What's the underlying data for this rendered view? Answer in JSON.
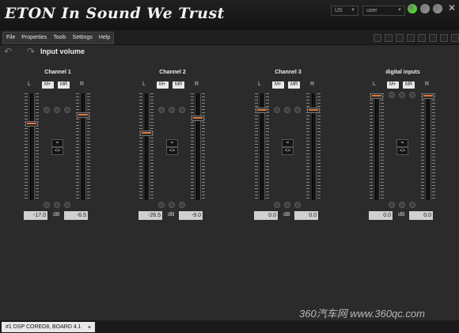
{
  "header": {
    "logo_text": "ETON In Sound We Trust",
    "language": "US",
    "user": "user",
    "close_symbol": "✕",
    "status_colors": [
      "#4fd42f",
      "#8c8c8c",
      "#8c8c8c"
    ]
  },
  "menu": [
    "File",
    "Properties",
    "Tools",
    "Settings",
    "Help"
  ],
  "nav": {
    "title": "Input volume",
    "back_symbol": "↶",
    "forward_symbol": "↷"
  },
  "channels": [
    {
      "title": "Channel 1",
      "left_label": "L",
      "right_label": "R",
      "m_plus": "M+",
      "m_r": "MR",
      "link_label": "=",
      "swap_label": "<>",
      "left_value": "-17.0",
      "right_value": "-6.5",
      "unit": "dB",
      "left_level": 0.26,
      "right_level": 0.18
    },
    {
      "title": "Channel 2",
      "left_label": "L",
      "right_label": "R",
      "m_plus": "M+",
      "m_r": "MR",
      "link_label": "=",
      "swap_label": "<>",
      "left_value": "-26.5",
      "right_value": "-9.0",
      "unit": "dB",
      "left_level": 0.35,
      "right_level": 0.21
    },
    {
      "title": "Channel 3",
      "left_label": "L",
      "right_label": "R",
      "m_plus": "M+",
      "m_r": "MR",
      "link_label": "=",
      "swap_label": "<>",
      "left_value": "0.0",
      "right_value": "0.0",
      "unit": "dB",
      "left_level": 0.13,
      "right_level": 0.13
    },
    {
      "title": "digital inputs",
      "left_label": "L",
      "right_label": "R",
      "m_plus": "M+",
      "m_r": "MR",
      "link_label": "=",
      "swap_label": "<>",
      "left_value": "0.0",
      "right_value": "0.0",
      "unit": "dB",
      "left_level": 0.0,
      "right_level": 0.0
    }
  ],
  "status": {
    "tab_label": "#1 DSP CORED8, BOARD 4.1",
    "add_label": "+"
  },
  "watermark": "360汽车网 www.360qc.com"
}
